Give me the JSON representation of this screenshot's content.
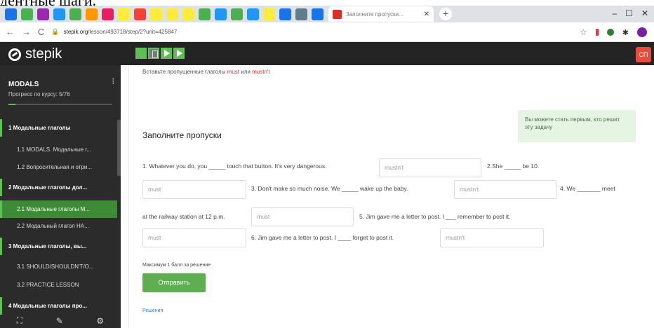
{
  "caption": "дентные шаги.",
  "browser": {
    "tab_title": "Заполните пропуски...",
    "new_tab": "+",
    "url_domain": "stepik.org",
    "url_rest": "/lesson/493718/step/2?unit=425847"
  },
  "header": {
    "logo": "stepik",
    "avatar": "СП"
  },
  "sidebar": {
    "course": "MODALS",
    "progress": "Прогресс по курсу: 5/76",
    "progress_fraction": 0.066,
    "items": [
      {
        "label": "1 Модальные глаголы",
        "kind": "sec"
      },
      {
        "label": "1.1 MODALS. Модальные г...",
        "kind": "sub"
      },
      {
        "label": "1.2 Вопросительная и отри...",
        "kind": "sub"
      },
      {
        "label": "2 Модальные глаголы дол...",
        "kind": "sec"
      },
      {
        "label": "2.1 Модальные глаголы M...",
        "kind": "active"
      },
      {
        "label": "2.2 Модальный глагол HA...",
        "kind": "sub"
      },
      {
        "label": "3 Модальные глаголы, вы...",
        "kind": "sec"
      },
      {
        "label": "3.1 SHOULD/SHOULDN'T/O...",
        "kind": "sub"
      },
      {
        "label": "3.2 PRACTICE LESSON",
        "kind": "sub"
      },
      {
        "label": "4 Модальные глаголы про...",
        "kind": "sec"
      }
    ]
  },
  "main": {
    "instruction_prefix": "Вставьте пропущенные глаголы",
    "instruction_w1": "must",
    "instruction_or": "или",
    "instruction_w2": "mustn't",
    "hint": "Вы можете стать первым, кто решит эту задачу",
    "heading": "Заполните пропуски",
    "s1": "1. Whatever you do, you _____ touch that button. It's very dangerous.",
    "b1": "mustn't",
    "s2a": "2.She _____ be 10.",
    "b2": "must",
    "s3": "3. Don't make so much noise. We _____ wake up the baby.",
    "b3": "mustn't",
    "s4a": "4. We _______ meet",
    "s4b": "at the railway station at 12 p.m.",
    "b4": "must",
    "s5": "5. Jim gave me a letter to post. I ___ remember to post it.",
    "b5": "must",
    "s6": "6. Jim gave me a letter to post. I ____ forget to post it.",
    "b6": "mustn't",
    "score": "Максимум 1 балл за решение",
    "submit": "Отправить",
    "solutions": "Решения"
  }
}
